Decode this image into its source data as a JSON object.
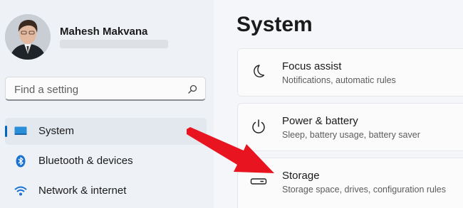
{
  "user": {
    "name": "Mahesh Makvana"
  },
  "search": {
    "placeholder": "Find a setting",
    "icon": "search-icon"
  },
  "sidebar": {
    "items": [
      {
        "label": "System",
        "icon": "system-monitor-icon",
        "selected": true
      },
      {
        "label": "Bluetooth & devices",
        "icon": "bluetooth-icon",
        "selected": false
      },
      {
        "label": "Network & internet",
        "icon": "wifi-icon",
        "selected": false
      }
    ]
  },
  "main": {
    "title": "System",
    "cards": [
      {
        "title": "Focus assist",
        "subtitle": "Notifications, automatic rules",
        "icon": "moon-icon"
      },
      {
        "title": "Power & battery",
        "subtitle": "Sleep, battery usage, battery saver",
        "icon": "power-icon"
      },
      {
        "title": "Storage",
        "subtitle": "Storage space, drives, configuration rules",
        "icon": "storage-drive-icon"
      }
    ]
  },
  "colors": {
    "accent": "#0067c0",
    "annotation_arrow": "#e8141f"
  }
}
